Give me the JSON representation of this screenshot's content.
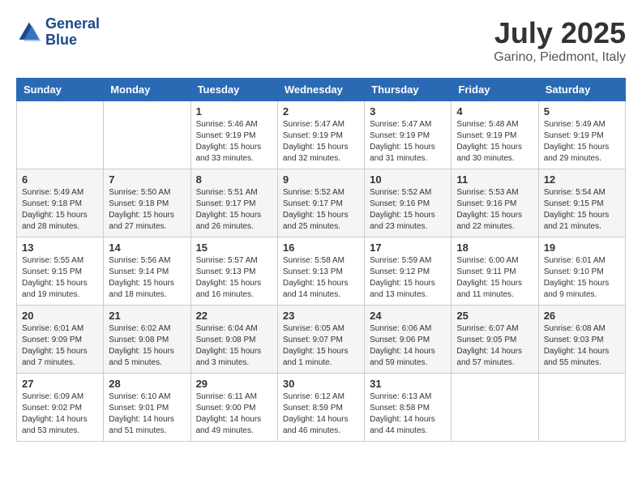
{
  "header": {
    "logo_line1": "General",
    "logo_line2": "Blue",
    "month_year": "July 2025",
    "location": "Garino, Piedmont, Italy"
  },
  "weekdays": [
    "Sunday",
    "Monday",
    "Tuesday",
    "Wednesday",
    "Thursday",
    "Friday",
    "Saturday"
  ],
  "weeks": [
    [
      {
        "day": "",
        "sunrise": "",
        "sunset": "",
        "daylight": ""
      },
      {
        "day": "",
        "sunrise": "",
        "sunset": "",
        "daylight": ""
      },
      {
        "day": "1",
        "sunrise": "Sunrise: 5:46 AM",
        "sunset": "Sunset: 9:19 PM",
        "daylight": "Daylight: 15 hours and 33 minutes."
      },
      {
        "day": "2",
        "sunrise": "Sunrise: 5:47 AM",
        "sunset": "Sunset: 9:19 PM",
        "daylight": "Daylight: 15 hours and 32 minutes."
      },
      {
        "day": "3",
        "sunrise": "Sunrise: 5:47 AM",
        "sunset": "Sunset: 9:19 PM",
        "daylight": "Daylight: 15 hours and 31 minutes."
      },
      {
        "day": "4",
        "sunrise": "Sunrise: 5:48 AM",
        "sunset": "Sunset: 9:19 PM",
        "daylight": "Daylight: 15 hours and 30 minutes."
      },
      {
        "day": "5",
        "sunrise": "Sunrise: 5:49 AM",
        "sunset": "Sunset: 9:19 PM",
        "daylight": "Daylight: 15 hours and 29 minutes."
      }
    ],
    [
      {
        "day": "6",
        "sunrise": "Sunrise: 5:49 AM",
        "sunset": "Sunset: 9:18 PM",
        "daylight": "Daylight: 15 hours and 28 minutes."
      },
      {
        "day": "7",
        "sunrise": "Sunrise: 5:50 AM",
        "sunset": "Sunset: 9:18 PM",
        "daylight": "Daylight: 15 hours and 27 minutes."
      },
      {
        "day": "8",
        "sunrise": "Sunrise: 5:51 AM",
        "sunset": "Sunset: 9:17 PM",
        "daylight": "Daylight: 15 hours and 26 minutes."
      },
      {
        "day": "9",
        "sunrise": "Sunrise: 5:52 AM",
        "sunset": "Sunset: 9:17 PM",
        "daylight": "Daylight: 15 hours and 25 minutes."
      },
      {
        "day": "10",
        "sunrise": "Sunrise: 5:52 AM",
        "sunset": "Sunset: 9:16 PM",
        "daylight": "Daylight: 15 hours and 23 minutes."
      },
      {
        "day": "11",
        "sunrise": "Sunrise: 5:53 AM",
        "sunset": "Sunset: 9:16 PM",
        "daylight": "Daylight: 15 hours and 22 minutes."
      },
      {
        "day": "12",
        "sunrise": "Sunrise: 5:54 AM",
        "sunset": "Sunset: 9:15 PM",
        "daylight": "Daylight: 15 hours and 21 minutes."
      }
    ],
    [
      {
        "day": "13",
        "sunrise": "Sunrise: 5:55 AM",
        "sunset": "Sunset: 9:15 PM",
        "daylight": "Daylight: 15 hours and 19 minutes."
      },
      {
        "day": "14",
        "sunrise": "Sunrise: 5:56 AM",
        "sunset": "Sunset: 9:14 PM",
        "daylight": "Daylight: 15 hours and 18 minutes."
      },
      {
        "day": "15",
        "sunrise": "Sunrise: 5:57 AM",
        "sunset": "Sunset: 9:13 PM",
        "daylight": "Daylight: 15 hours and 16 minutes."
      },
      {
        "day": "16",
        "sunrise": "Sunrise: 5:58 AM",
        "sunset": "Sunset: 9:13 PM",
        "daylight": "Daylight: 15 hours and 14 minutes."
      },
      {
        "day": "17",
        "sunrise": "Sunrise: 5:59 AM",
        "sunset": "Sunset: 9:12 PM",
        "daylight": "Daylight: 15 hours and 13 minutes."
      },
      {
        "day": "18",
        "sunrise": "Sunrise: 6:00 AM",
        "sunset": "Sunset: 9:11 PM",
        "daylight": "Daylight: 15 hours and 11 minutes."
      },
      {
        "day": "19",
        "sunrise": "Sunrise: 6:01 AM",
        "sunset": "Sunset: 9:10 PM",
        "daylight": "Daylight: 15 hours and 9 minutes."
      }
    ],
    [
      {
        "day": "20",
        "sunrise": "Sunrise: 6:01 AM",
        "sunset": "Sunset: 9:09 PM",
        "daylight": "Daylight: 15 hours and 7 minutes."
      },
      {
        "day": "21",
        "sunrise": "Sunrise: 6:02 AM",
        "sunset": "Sunset: 9:08 PM",
        "daylight": "Daylight: 15 hours and 5 minutes."
      },
      {
        "day": "22",
        "sunrise": "Sunrise: 6:04 AM",
        "sunset": "Sunset: 9:08 PM",
        "daylight": "Daylight: 15 hours and 3 minutes."
      },
      {
        "day": "23",
        "sunrise": "Sunrise: 6:05 AM",
        "sunset": "Sunset: 9:07 PM",
        "daylight": "Daylight: 15 hours and 1 minute."
      },
      {
        "day": "24",
        "sunrise": "Sunrise: 6:06 AM",
        "sunset": "Sunset: 9:06 PM",
        "daylight": "Daylight: 14 hours and 59 minutes."
      },
      {
        "day": "25",
        "sunrise": "Sunrise: 6:07 AM",
        "sunset": "Sunset: 9:05 PM",
        "daylight": "Daylight: 14 hours and 57 minutes."
      },
      {
        "day": "26",
        "sunrise": "Sunrise: 6:08 AM",
        "sunset": "Sunset: 9:03 PM",
        "daylight": "Daylight: 14 hours and 55 minutes."
      }
    ],
    [
      {
        "day": "27",
        "sunrise": "Sunrise: 6:09 AM",
        "sunset": "Sunset: 9:02 PM",
        "daylight": "Daylight: 14 hours and 53 minutes."
      },
      {
        "day": "28",
        "sunrise": "Sunrise: 6:10 AM",
        "sunset": "Sunset: 9:01 PM",
        "daylight": "Daylight: 14 hours and 51 minutes."
      },
      {
        "day": "29",
        "sunrise": "Sunrise: 6:11 AM",
        "sunset": "Sunset: 9:00 PM",
        "daylight": "Daylight: 14 hours and 49 minutes."
      },
      {
        "day": "30",
        "sunrise": "Sunrise: 6:12 AM",
        "sunset": "Sunset: 8:59 PM",
        "daylight": "Daylight: 14 hours and 46 minutes."
      },
      {
        "day": "31",
        "sunrise": "Sunrise: 6:13 AM",
        "sunset": "Sunset: 8:58 PM",
        "daylight": "Daylight: 14 hours and 44 minutes."
      },
      {
        "day": "",
        "sunrise": "",
        "sunset": "",
        "daylight": ""
      },
      {
        "day": "",
        "sunrise": "",
        "sunset": "",
        "daylight": ""
      }
    ]
  ]
}
